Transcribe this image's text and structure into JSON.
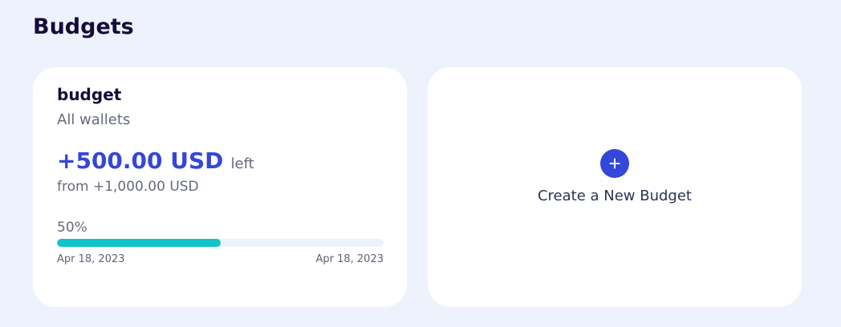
{
  "page": {
    "title": "Budgets"
  },
  "budget_card": {
    "name": "budget",
    "wallets": "All wallets",
    "remaining": "+500.00 USD",
    "remaining_suffix": "left",
    "total": "from +1,000.00 USD",
    "progress_label": "50%",
    "progress_fraction": 0.5,
    "start_date": "Apr 18, 2023",
    "end_date": "Apr 18, 2023"
  },
  "create_card": {
    "icon": "plus-icon",
    "label": "Create a New Budget"
  },
  "colors": {
    "background": "#eef2fd",
    "accent": "#3447d8",
    "progress": "#11c4cb",
    "title": "#160a3a",
    "muted": "#656a7c"
  }
}
